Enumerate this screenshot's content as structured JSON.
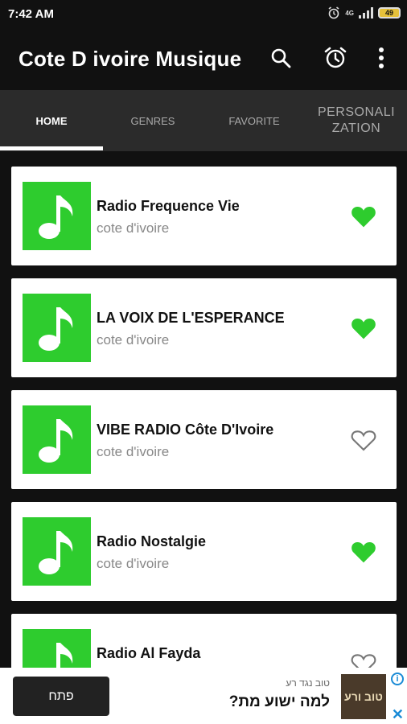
{
  "status": {
    "time": "7:42 AM",
    "network": "4G",
    "battery": "49"
  },
  "app": {
    "title": "Cote D ivoire Musique"
  },
  "tabs": [
    {
      "label": "HOME",
      "active": true
    },
    {
      "label": "GENRES",
      "active": false
    },
    {
      "label": "FAVORITE",
      "active": false
    },
    {
      "label": "PERSONALI ZATION",
      "active": false
    }
  ],
  "stations": [
    {
      "name": "Radio Frequence Vie",
      "subtitle": "cote d'ivoire",
      "favorite": true
    },
    {
      "name": "LA VOIX DE L'ESPERANCE",
      "subtitle": "cote d'ivoire",
      "favorite": true
    },
    {
      "name": "VIBE RADIO Côte D'Ivoire",
      "subtitle": "cote d'ivoire",
      "favorite": false
    },
    {
      "name": "Radio Nostalgie",
      "subtitle": "cote d'ivoire",
      "favorite": true
    },
    {
      "name": "Radio Al Fayda",
      "subtitle": "",
      "favorite": false
    }
  ],
  "colors": {
    "accent": "#2ecc2e",
    "bar": "#111111",
    "tabs": "#2b2b2b"
  },
  "ad": {
    "button_label": "פתח",
    "small_text": "טוב נגד רע",
    "headline": "למה ישוע מת?",
    "image_text": "טוב ורע"
  }
}
